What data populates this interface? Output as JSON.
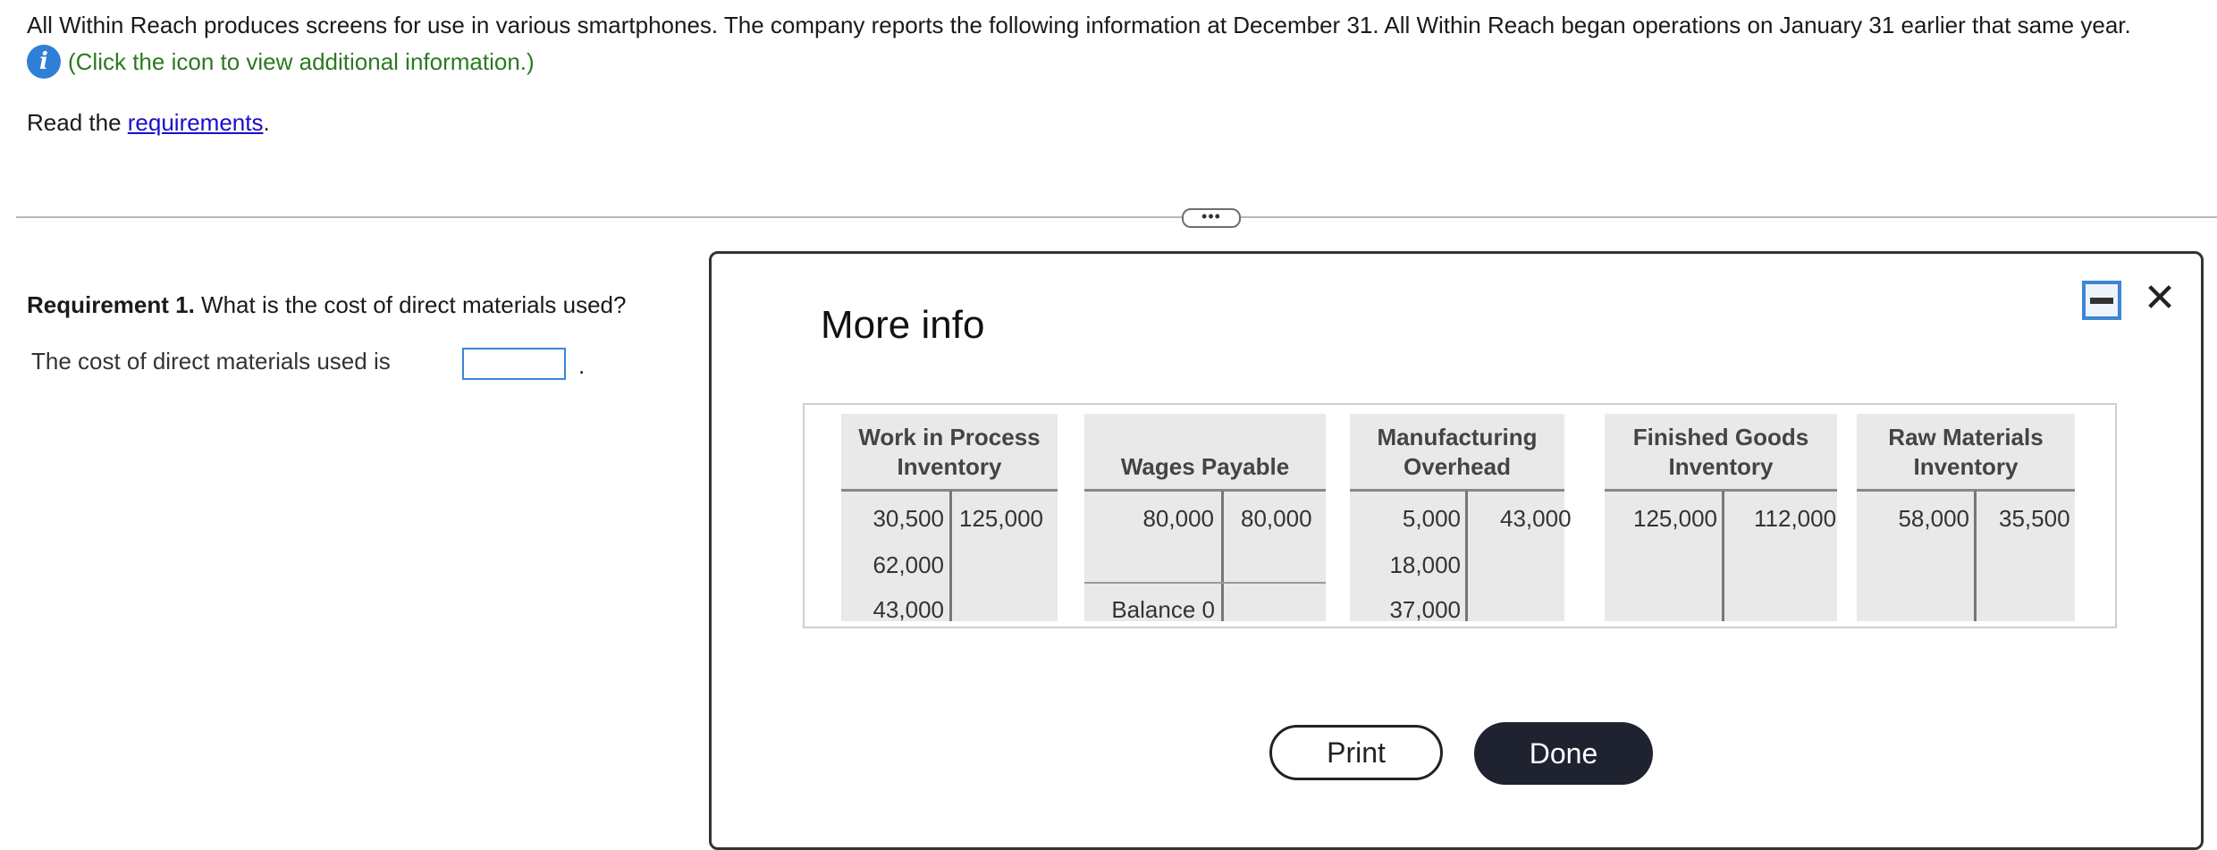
{
  "intro": "All Within Reach produces screens for use in various smartphones. The company reports the following information at December 31. All Within Reach began operations on January 31 earlier that same year.",
  "info_icon": "info-icon",
  "info_text": "(Click the icon to view additional information.)",
  "read_prefix": "Read the ",
  "requirements_link": "requirements",
  "read_suffix": ".",
  "expander_text": "•••",
  "requirement1": {
    "label": "Requirement 1.",
    "question": " What is the cost of direct materials used?",
    "answer_prompt": "The cost of direct materials used is",
    "answer_value": "",
    "period": "."
  },
  "modal": {
    "title": "More info",
    "minimize_icon": "minimize-icon",
    "close_symbol": "✕",
    "accounts": {
      "wip": {
        "title1": "Work in Process",
        "title2": "Inventory",
        "debits": [
          "30,500",
          "62,000",
          "43,000"
        ],
        "credits": [
          "125,000"
        ]
      },
      "wages": {
        "title": "Wages Payable",
        "debit": "80,000",
        "credit": "80,000",
        "balance": "Balance 0"
      },
      "moh": {
        "title1": "Manufacturing",
        "title2": "Overhead",
        "debits": [
          "5,000",
          "18,000",
          "37,000"
        ],
        "credits": [
          "43,000"
        ]
      },
      "fg": {
        "title1": "Finished Goods",
        "title2": "Inventory",
        "debits": [
          "125,000"
        ],
        "credits": [
          "112,000"
        ]
      },
      "rm": {
        "title1": "Raw Materials",
        "title2": "Inventory",
        "debits": [
          "58,000"
        ],
        "credits": [
          "35,500"
        ]
      }
    },
    "print_label": "Print",
    "done_label": "Done"
  }
}
